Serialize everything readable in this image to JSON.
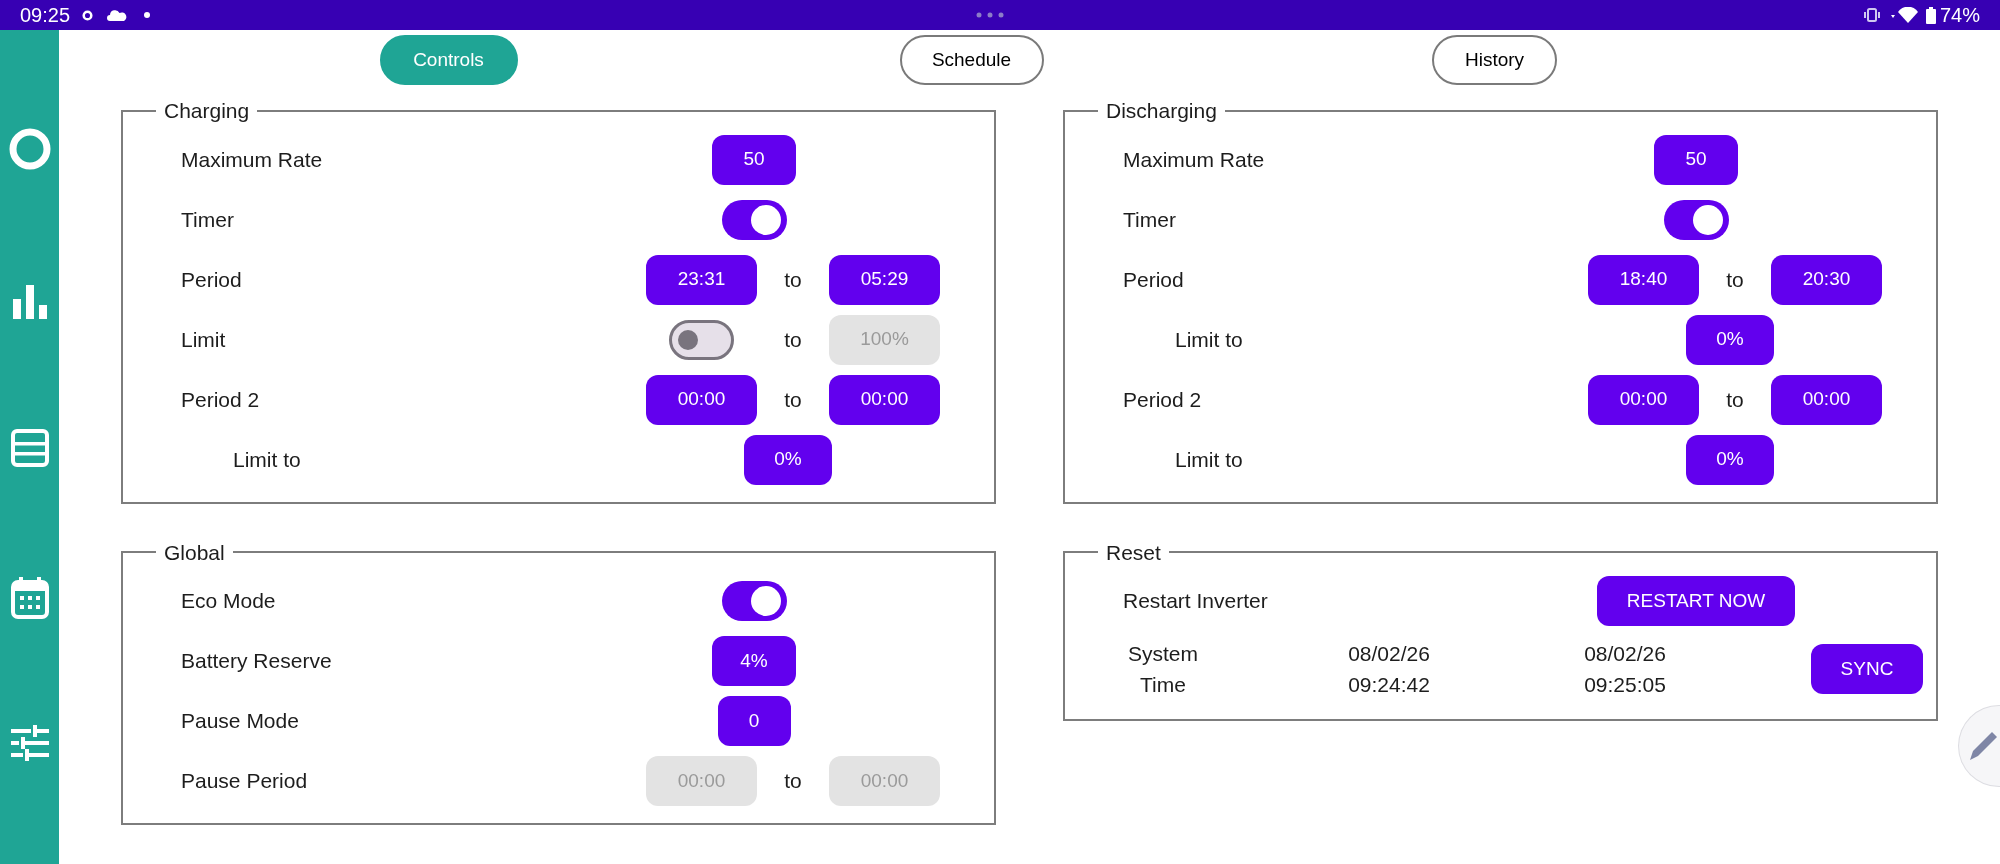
{
  "status_bar": {
    "time": "09:25",
    "battery": "74%"
  },
  "tabs": [
    {
      "label": "Controls",
      "selected": true
    },
    {
      "label": "Schedule",
      "selected": false
    },
    {
      "label": "History",
      "selected": false
    }
  ],
  "panels": [
    {
      "title": "Charging",
      "rows": [
        {
          "kind": "number",
          "label": "Maximum Rate",
          "value": "50",
          "disabled": false
        },
        {
          "kind": "toggle",
          "label": "Timer",
          "on": true
        },
        {
          "kind": "period",
          "label": "Period",
          "from": "23:31",
          "to_word": "to",
          "to": "05:29",
          "disabled": false
        },
        {
          "kind": "limit",
          "label": "Limit",
          "on": false,
          "to_word": "to",
          "value": "100%",
          "disabled": true
        },
        {
          "kind": "period",
          "label": "Period 2",
          "from": "00:00",
          "to_word": "to",
          "to": "00:00",
          "disabled": false
        },
        {
          "kind": "limit_to",
          "label": "Limit to",
          "value": "0%",
          "disabled": false
        }
      ]
    },
    {
      "title": "Discharging",
      "rows": [
        {
          "kind": "number",
          "label": "Maximum Rate",
          "value": "50",
          "disabled": false
        },
        {
          "kind": "toggle",
          "label": "Timer",
          "on": true
        },
        {
          "kind": "period",
          "label": "Period",
          "from": "18:40",
          "to_word": "to",
          "to": "20:30",
          "disabled": false
        },
        {
          "kind": "limit_to",
          "label": "Limit to",
          "value": "0%",
          "disabled": false
        },
        {
          "kind": "period",
          "label": "Period 2",
          "from": "00:00",
          "to_word": "to",
          "to": "00:00",
          "disabled": false
        },
        {
          "kind": "limit_to",
          "label": "Limit to",
          "value": "0%",
          "disabled": false
        }
      ]
    },
    {
      "title": "Global",
      "rows": [
        {
          "kind": "toggle",
          "label": "Eco Mode",
          "on": true
        },
        {
          "kind": "number",
          "label": "Battery Reserve",
          "value": "4%",
          "disabled": false
        },
        {
          "kind": "number",
          "label": "Pause Mode",
          "value": "0",
          "disabled": false
        },
        {
          "kind": "period",
          "label": "Pause Period",
          "from": "00:00",
          "to_word": "to",
          "to": "00:00",
          "disabled": true
        }
      ]
    },
    {
      "title": "Reset",
      "rows": [
        {
          "kind": "action",
          "label": "Restart Inverter",
          "button": "RESTART NOW"
        },
        {
          "kind": "time_sync",
          "label_lines": [
            "System",
            "Time"
          ],
          "inverter_date": "08/02/26",
          "inverter_time": "09:24:42",
          "device_date": "08/02/26",
          "device_time": "09:25:05",
          "button": "SYNC"
        }
      ]
    }
  ]
}
